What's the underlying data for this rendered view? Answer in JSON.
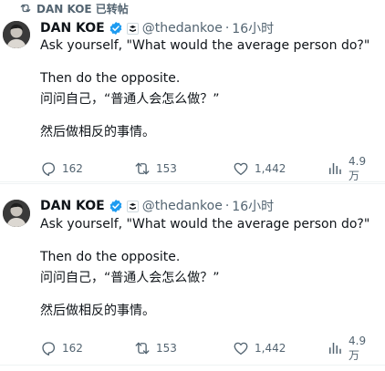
{
  "repost_header": {
    "text": "DAN KOE 已转帖"
  },
  "tweets": [
    {
      "author_name": "DAN KOE",
      "handle": "@thedankoe",
      "separator": "·",
      "time": "16小时",
      "lines": [
        "Ask yourself, \"What would the average person do?\"",
        "Then do the opposite.",
        "问问自己，“普通人会怎么做？”",
        "然后做相反的事情。"
      ],
      "actions": {
        "replies": "162",
        "reposts": "153",
        "likes": "1,442",
        "views": "4.9万"
      }
    },
    {
      "author_name": "DAN KOE",
      "handle": "@thedankoe",
      "separator": "·",
      "time": "16小时",
      "lines": [
        "Ask yourself, \"What would the average person do?\"",
        "Then do the opposite.",
        "问问自己，“普通人会怎么做？”",
        "然后做相反的事情。"
      ],
      "actions": {
        "replies": "162",
        "reposts": "153",
        "likes": "1,442",
        "views": "4.9万"
      }
    }
  ],
  "icons": {
    "repost_header_icon": "repost-icon",
    "verified_icon": "verified-badge-icon",
    "affiliate_icon": "affiliate-badge-icon",
    "reply_icon": "reply-icon",
    "repost_icon": "repost-icon",
    "like_icon": "heart-icon",
    "views_icon": "views-icon"
  },
  "colors": {
    "text_primary": "#0f1419",
    "text_secondary": "#536471",
    "verified_blue": "#1d9bf0",
    "divider": "#eff3f4"
  }
}
